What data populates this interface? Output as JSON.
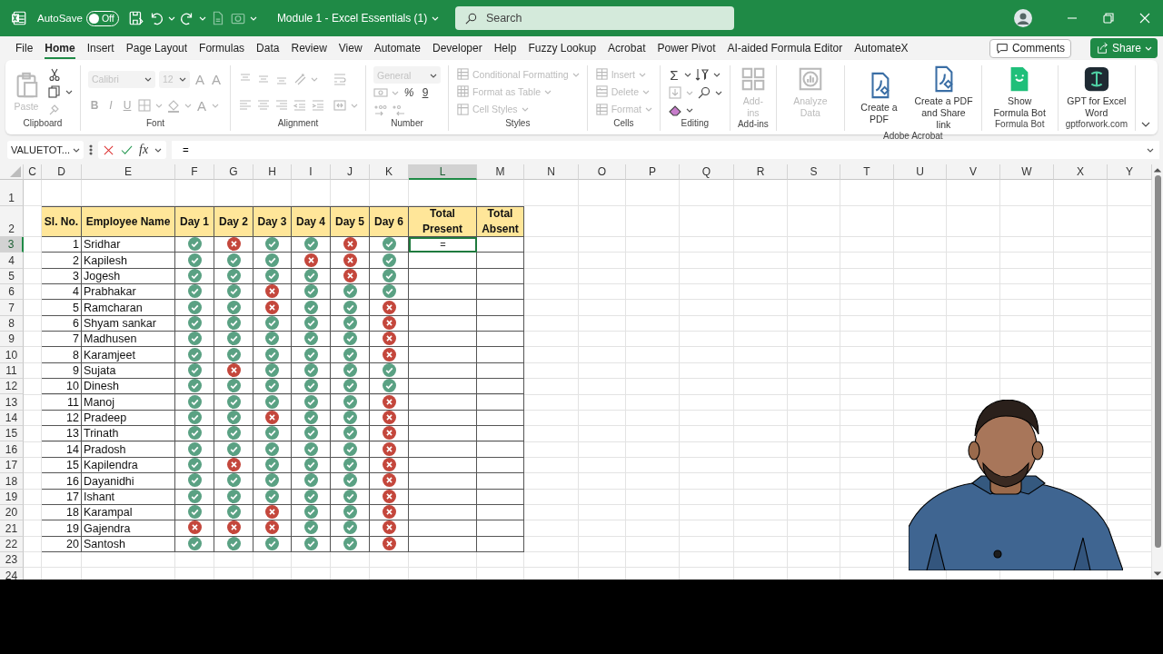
{
  "title_bar": {
    "autosave_label": "AutoSave",
    "autosave": {
      "on": false,
      "label": "Off"
    },
    "quick_access": [
      {
        "disabled": false
      },
      {
        "disabled": false
      },
      {
        "disabled": false
      },
      {
        "disabled": true
      },
      {
        "disabled": true
      }
    ],
    "document_title": "Module 1 - Excel Essentials (1)",
    "search": {
      "placeholder": "Search"
    }
  },
  "menu_tabs": [
    {
      "label": "File",
      "selected": false
    },
    {
      "label": "Home",
      "selected": true
    },
    {
      "label": "Insert",
      "selected": false
    },
    {
      "label": "Page Layout",
      "selected": false
    },
    {
      "label": "Formulas",
      "selected": false
    },
    {
      "label": "Data",
      "selected": false
    },
    {
      "label": "Review",
      "selected": false
    },
    {
      "label": "View",
      "selected": false
    },
    {
      "label": "Automate",
      "selected": false
    },
    {
      "label": "Developer",
      "selected": false
    },
    {
      "label": "Help",
      "selected": false
    },
    {
      "label": "Fuzzy Lookup",
      "selected": false
    },
    {
      "label": "Acrobat",
      "selected": false
    },
    {
      "label": "Power Pivot",
      "selected": false
    },
    {
      "label": "AI-aided Formula Editor",
      "selected": false
    },
    {
      "label": "AutomateX",
      "selected": false
    }
  ],
  "comments_button": "Comments",
  "share_button": "Share",
  "ribbon": {
    "groups": [
      {
        "label": "Clipboard",
        "columns": [
          [
            [
              {
                "kind": "large",
                "label": "Paste",
                "disabled": true
              }
            ]
          ],
          [
            [
              {
                "kind": "icon",
                "disabled": false
              }
            ],
            [
              {
                "kind": "icon",
                "disabled": false,
                "dropdown": true
              }
            ],
            [
              {
                "kind": "icon",
                "disabled": true
              }
            ]
          ]
        ]
      },
      {
        "label": "Font",
        "columns": [
          [
            [
              {
                "kind": "field",
                "label": "Calibri",
                "disabled": true,
                "dropdown": true
              },
              {
                "kind": "field",
                "label": "12",
                "disabled": true,
                "dropdown": true
              },
              {
                "kind": "glyph",
                "label": "A",
                "disabled": true
              },
              {
                "kind": "glyph",
                "label": "A",
                "disabled": true
              }
            ],
            [
              {
                "kind": "glyph",
                "label": "B",
                "disabled": true
              },
              {
                "kind": "glyph",
                "label": "I",
                "disabled": true
              },
              {
                "kind": "glyph",
                "label": "U",
                "disabled": true
              },
              {
                "kind": "icon",
                "disabled": true,
                "dropdown": true
              },
              {
                "kind": "icon",
                "disabled": true,
                "dropdown": true
              },
              {
                "kind": "glyph",
                "label": "A",
                "disabled": true,
                "dropdown": true
              }
            ]
          ]
        ]
      },
      {
        "label": "Alignment",
        "columns": [
          [
            [
              {
                "kind": "icon",
                "disabled": true
              },
              {
                "kind": "icon",
                "disabled": true
              },
              {
                "kind": "icon",
                "disabled": true
              },
              {
                "kind": "icon",
                "disabled": true,
                "dropdown": true
              }
            ],
            [
              {
                "kind": "icon",
                "disabled": true
              },
              {
                "kind": "icon",
                "disabled": true
              },
              {
                "kind": "icon",
                "disabled": true
              },
              {
                "kind": "icon",
                "disabled": true
              },
              {
                "kind": "icon",
                "disabled": true
              }
            ]
          ],
          [
            [
              {
                "kind": "icon",
                "disabled": true
              }
            ],
            [
              {
                "kind": "icon",
                "disabled": true,
                "dropdown": true
              }
            ]
          ]
        ]
      },
      {
        "label": "Number",
        "columns": [
          [
            [
              {
                "kind": "field",
                "label": "General",
                "disabled": true,
                "dropdown": true
              }
            ],
            [
              {
                "kind": "icon",
                "disabled": true,
                "dropdown": true
              },
              {
                "kind": "glyph",
                "label": "%",
                "disabled": false
              },
              {
                "kind": "glyph",
                "label": "9",
                "disabled": false
              }
            ],
            [
              {
                "kind": "icon",
                "disabled": true
              },
              {
                "kind": "icon",
                "disabled": true
              }
            ]
          ]
        ]
      },
      {
        "label": "Styles",
        "columns": [
          [
            [
              {
                "kind": "small",
                "label": "Conditional Formatting",
                "disabled": true,
                "dropdown": true
              }
            ],
            [
              {
                "kind": "small",
                "label": "Format as Table",
                "disabled": true,
                "dropdown": true
              }
            ],
            [
              {
                "kind": "small",
                "label": "Cell Styles",
                "disabled": true,
                "dropdown": true
              }
            ]
          ]
        ]
      },
      {
        "label": "Cells",
        "columns": [
          [
            [
              {
                "kind": "small",
                "label": "Insert",
                "disabled": true,
                "dropdown": true
              }
            ],
            [
              {
                "kind": "small",
                "label": "Delete",
                "disabled": true,
                "dropdown": true
              }
            ],
            [
              {
                "kind": "small",
                "label": "Format",
                "disabled": true,
                "dropdown": true
              }
            ]
          ]
        ]
      },
      {
        "label": "Editing",
        "columns": [
          [
            [
              {
                "kind": "glyph",
                "label": "Σ",
                "disabled": false,
                "dropdown": true
              },
              {
                "kind": "icon",
                "disabled": false,
                "dropdown": true
              }
            ],
            [
              {
                "kind": "icon",
                "disabled": true,
                "dropdown": true
              },
              {
                "kind": "icon",
                "disabled": false,
                "dropdown": true
              }
            ],
            [
              {
                "kind": "icon",
                "disabled": false,
                "dropdown": true
              }
            ]
          ]
        ]
      },
      {
        "label": "Add-ins",
        "columns": [
          [
            [
              {
                "kind": "large",
                "label": "Add-ins",
                "disabled": true
              }
            ]
          ]
        ]
      },
      {
        "columns": [
          [
            [
              {
                "kind": "large",
                "label": "Analyze Data",
                "disabled": true
              }
            ]
          ]
        ]
      },
      {
        "label": "Adobe Acrobat",
        "columns": [
          [
            [
              {
                "kind": "large",
                "label": "Create a PDF",
                "disabled": false
              }
            ]
          ],
          [
            [
              {
                "kind": "large",
                "label": "Create a PDF and Share link",
                "disabled": false
              }
            ]
          ]
        ]
      },
      {
        "label": "Formula Bot",
        "columns": [
          [
            [
              {
                "kind": "large",
                "label": "Show Formula Bot",
                "disabled": false
              }
            ]
          ]
        ]
      },
      {
        "label": "gptforwork.com",
        "columns": [
          [
            [
              {
                "kind": "large",
                "label": "GPT for Excel Word",
                "disabled": false
              }
            ]
          ]
        ]
      }
    ]
  },
  "formula_bar": {
    "name_box": "VALUETOT...",
    "fx": "fx",
    "formula": "="
  },
  "sheet": {
    "columns": [
      {
        "label": "C",
        "selected": false
      },
      {
        "label": "D",
        "selected": false
      },
      {
        "label": "E",
        "selected": false
      },
      {
        "label": "F",
        "selected": false
      },
      {
        "label": "G",
        "selected": false
      },
      {
        "label": "H",
        "selected": false
      },
      {
        "label": "I",
        "selected": false
      },
      {
        "label": "J",
        "selected": false
      },
      {
        "label": "K",
        "selected": false
      },
      {
        "label": "L",
        "selected": true
      },
      {
        "label": "M",
        "selected": false
      },
      {
        "label": "N",
        "selected": false
      },
      {
        "label": "O",
        "selected": false
      },
      {
        "label": "P",
        "selected": false
      },
      {
        "label": "Q",
        "selected": false
      },
      {
        "label": "R",
        "selected": false
      },
      {
        "label": "S",
        "selected": false
      },
      {
        "label": "T",
        "selected": false
      },
      {
        "label": "U",
        "selected": false
      },
      {
        "label": "V",
        "selected": false
      },
      {
        "label": "W",
        "selected": false
      },
      {
        "label": "X",
        "selected": false
      },
      {
        "label": "Y",
        "selected": false
      }
    ],
    "rows": [
      {
        "label": "1",
        "selected": false
      },
      {
        "label": "2",
        "selected": false
      },
      {
        "label": "3",
        "selected": true
      },
      {
        "label": "4",
        "selected": false
      },
      {
        "label": "5",
        "selected": false
      },
      {
        "label": "6",
        "selected": false
      },
      {
        "label": "7",
        "selected": false
      },
      {
        "label": "8",
        "selected": false
      },
      {
        "label": "9",
        "selected": false
      },
      {
        "label": "10",
        "selected": false
      },
      {
        "label": "11",
        "selected": false
      },
      {
        "label": "12",
        "selected": false
      },
      {
        "label": "13",
        "selected": false
      },
      {
        "label": "14",
        "selected": false
      },
      {
        "label": "15",
        "selected": false
      },
      {
        "label": "16",
        "selected": false
      },
      {
        "label": "17",
        "selected": false
      },
      {
        "label": "18",
        "selected": false
      },
      {
        "label": "19",
        "selected": false
      },
      {
        "label": "20",
        "selected": false
      },
      {
        "label": "21",
        "selected": false
      },
      {
        "label": "22",
        "selected": false
      },
      {
        "label": "23",
        "selected": false
      },
      {
        "label": "24",
        "selected": false
      }
    ],
    "table": {
      "headers": [
        "Sl. No.",
        "Employee Name",
        "Day 1",
        "Day 2",
        "Day 3",
        "Day 4",
        "Day 5",
        "Day 6",
        "Total Present",
        "Total Absent"
      ],
      "rows": [
        {
          "sl": "1",
          "name": "Sridhar",
          "attendance": [
            true,
            false,
            true,
            true,
            false,
            true
          ],
          "entry": {
            "value": "=",
            "active": true
          }
        },
        {
          "sl": "2",
          "name": "Kapilesh",
          "attendance": [
            true,
            true,
            true,
            false,
            false,
            true
          ]
        },
        {
          "sl": "3",
          "name": "Jogesh",
          "attendance": [
            true,
            true,
            true,
            true,
            false,
            true
          ]
        },
        {
          "sl": "4",
          "name": "Prabhakar",
          "attendance": [
            true,
            true,
            false,
            true,
            true,
            true
          ]
        },
        {
          "sl": "5",
          "name": "Ramcharan",
          "attendance": [
            true,
            true,
            false,
            true,
            true,
            false
          ]
        },
        {
          "sl": "6",
          "name": "Shyam sankar",
          "attendance": [
            true,
            true,
            true,
            true,
            true,
            false
          ]
        },
        {
          "sl": "7",
          "name": "Madhusen",
          "attendance": [
            true,
            true,
            true,
            true,
            true,
            false
          ]
        },
        {
          "sl": "8",
          "name": "Karamjeet",
          "attendance": [
            true,
            true,
            true,
            true,
            true,
            false
          ]
        },
        {
          "sl": "9",
          "name": "Sujata",
          "attendance": [
            true,
            false,
            true,
            true,
            true,
            true
          ]
        },
        {
          "sl": "10",
          "name": "Dinesh",
          "attendance": [
            true,
            true,
            true,
            true,
            true,
            true
          ]
        },
        {
          "sl": "11",
          "name": "Manoj",
          "attendance": [
            true,
            true,
            true,
            true,
            true,
            false
          ]
        },
        {
          "sl": "12",
          "name": "Pradeep",
          "attendance": [
            true,
            true,
            false,
            true,
            true,
            false
          ]
        },
        {
          "sl": "13",
          "name": "Trinath",
          "attendance": [
            true,
            true,
            true,
            true,
            true,
            false
          ]
        },
        {
          "sl": "14",
          "name": "Pradosh",
          "attendance": [
            true,
            true,
            true,
            true,
            true,
            false
          ]
        },
        {
          "sl": "15",
          "name": "Kapilendra",
          "attendance": [
            true,
            false,
            true,
            true,
            true,
            false
          ]
        },
        {
          "sl": "16",
          "name": "Dayanidhi",
          "attendance": [
            true,
            true,
            true,
            true,
            true,
            false
          ]
        },
        {
          "sl": "17",
          "name": "Ishant",
          "attendance": [
            true,
            true,
            true,
            true,
            true,
            false
          ]
        },
        {
          "sl": "18",
          "name": "Karampal",
          "attendance": [
            true,
            true,
            false,
            true,
            true,
            false
          ]
        },
        {
          "sl": "19",
          "name": "Gajendra",
          "attendance": [
            false,
            false,
            false,
            true,
            true,
            false
          ]
        },
        {
          "sl": "20",
          "name": "Santosh",
          "attendance": [
            true,
            true,
            true,
            true,
            true,
            false
          ]
        }
      ]
    }
  }
}
